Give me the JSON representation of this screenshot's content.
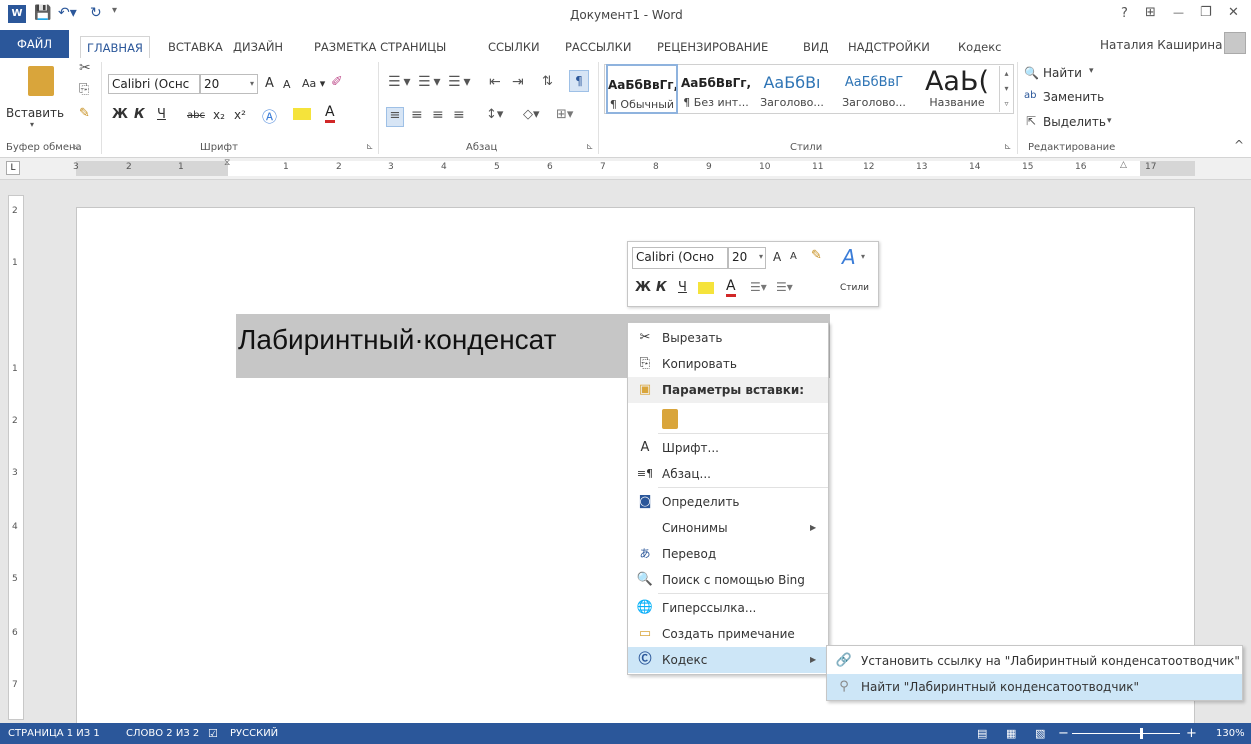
{
  "window": {
    "title": "Документ1 - Word",
    "help": "?",
    "ribbon_display": "⊞",
    "minimize": "—",
    "restore": "❐",
    "close": "✕"
  },
  "user": {
    "name": "Наталия Каширина ▾"
  },
  "tabs": [
    "ФАЙЛ",
    "ГЛАВНАЯ",
    "ВСТАВКА",
    "ДИЗАЙН",
    "РАЗМЕТКА СТРАНИЦЫ",
    "ССЫЛКИ",
    "РАССЫЛКИ",
    "РЕЦЕНЗИРОВАНИЕ",
    "ВИД",
    "НАДСТРОЙКИ",
    "Кодекс"
  ],
  "ribbon": {
    "paste_label": "Вставить",
    "font_name": "Calibri (Оснс",
    "font_size": "20",
    "case_btn": "Aa ▾",
    "grow": "A",
    "shrink": "A",
    "bold": "Ж",
    "italic": "К",
    "underline": "Ч",
    "strike": "abc",
    "sub": "x₂",
    "sup": "x²",
    "groups": {
      "clipboard": "Буфер обмена",
      "font": "Шрифт",
      "paragraph": "Абзац",
      "styles": "Стили",
      "editing": "Редактирование"
    },
    "styles": [
      {
        "preview": "АаБбВвГг,",
        "name": "¶ Обычный"
      },
      {
        "preview": "АаБбВвГг,",
        "name": "¶ Без инт..."
      },
      {
        "preview": "АаБбВı",
        "name": "Заголово..."
      },
      {
        "preview": "АаБбВвГ",
        "name": "Заголово..."
      },
      {
        "preview": "АаЬ(",
        "name": "Название"
      }
    ],
    "find": "Найти",
    "replace": "Заменить",
    "select": "Выделить"
  },
  "ruler": {
    "h_ticks": [
      "3",
      "2",
      "1",
      "1",
      "2",
      "3",
      "4",
      "5",
      "6",
      "7",
      "8",
      "9",
      "10",
      "11",
      "12",
      "13",
      "14",
      "15",
      "16",
      "17"
    ],
    "v_ticks": [
      "2",
      "1",
      "1",
      "2",
      "3",
      "4",
      "5",
      "6",
      "7"
    ],
    "tab_selector": "L"
  },
  "document": {
    "text": "Лабиринтный·конденсат"
  },
  "mini_toolbar": {
    "font": "Calibri (Осно",
    "size": "20",
    "bold": "Ж",
    "italic": "К",
    "underline": "Ч",
    "styles_label": "Стили"
  },
  "context_menu": {
    "cut": "Вырезать",
    "copy": "Копировать",
    "paste_options": "Параметры вставки:",
    "font": "Шрифт...",
    "paragraph": "Абзац...",
    "define": "Определить",
    "synonyms": "Синонимы",
    "translate": "Перевод",
    "bing": "Поиск с помощью Bing",
    "hyperlink": "Гиперссылка...",
    "comment": "Создать примечание",
    "kodeks": "Кодекс"
  },
  "submenu": {
    "set_link": "Установить ссылку на \"Лабиринтный конденсатоотводчик\"",
    "find": "Найти \"Лабиринтный конденсатоотводчик\""
  },
  "status": {
    "page": "СТРАНИЦА 1 ИЗ 1",
    "words": "СЛОВО 2 ИЗ 2",
    "lang": "РУССКИЙ",
    "zoom": "130%"
  },
  "colors": {
    "accent": "#2b579a",
    "selection": "#c6c6c6",
    "highlight": "#cde6f7"
  }
}
